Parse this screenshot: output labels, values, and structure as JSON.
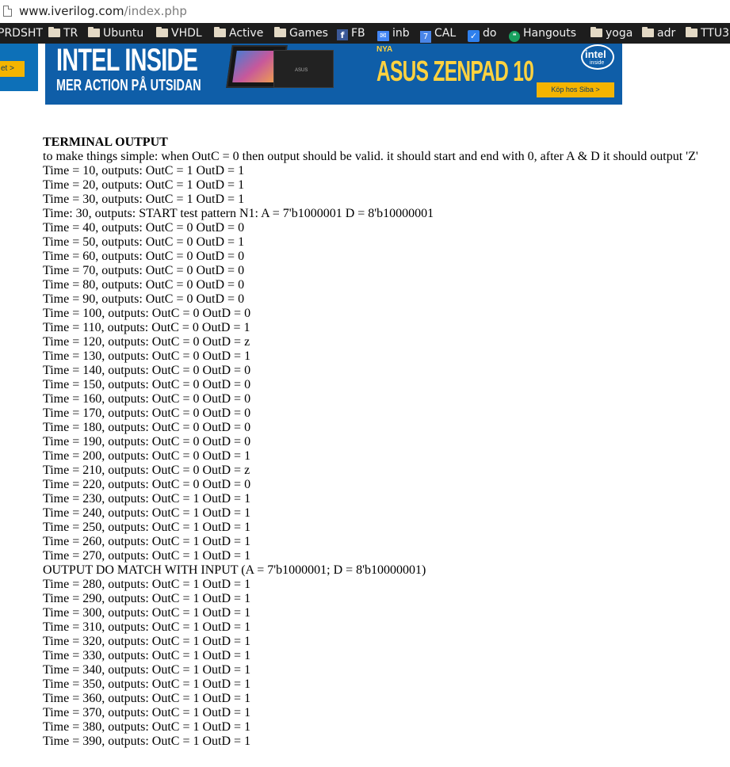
{
  "address_bar": {
    "domain": "www.iverilog.com",
    "path": "/index.php"
  },
  "bookmarks": [
    {
      "label": "PRDSHT",
      "icon": "none"
    },
    {
      "label": "TR",
      "icon": "folder-icon"
    },
    {
      "label": "Ubuntu",
      "icon": "folder-icon"
    },
    {
      "label": "VHDL",
      "icon": "folder-icon"
    },
    {
      "label": "Active",
      "icon": "folder-icon"
    },
    {
      "label": "Games",
      "icon": "folder-icon"
    },
    {
      "label": "FB",
      "icon": "facebook-icon"
    },
    {
      "label": "inb",
      "icon": "inbox-icon"
    },
    {
      "label": "CAL",
      "icon": "calendar-icon"
    },
    {
      "label": "do",
      "icon": "checkmark-icon"
    },
    {
      "label": "Hangouts",
      "icon": "hangouts-icon"
    },
    {
      "label": "yoga",
      "icon": "folder-icon"
    },
    {
      "label": "adr",
      "icon": "folder-icon"
    },
    {
      "label": "TTU3",
      "icon": "folder-icon"
    }
  ],
  "ads": {
    "side_button": "et >",
    "banner": {
      "headline": "INTEL INSIDE",
      "tagline": "MER ACTION PÅ UTSIDAN",
      "tablet_logo": "ASUS",
      "kicker": "NYA",
      "product": "ASUS ZENPAD 10",
      "intel_word": "intel",
      "intel_sub": "inside",
      "cta": "Köp hos Siba >"
    }
  },
  "terminal": {
    "heading": "TERMINAL OUTPUT",
    "lines": [
      "to make things simple: when OutC = 0 then output should be valid. it should start and end with 0, after A & D it should output 'Z'",
      "Time = 10, outputs: OutC = 1 OutD = 1",
      "Time = 20, outputs: OutC = 1 OutD = 1",
      "Time = 30, outputs: OutC = 1 OutD = 1",
      "Time: 30, outputs: START test pattern N1: A = 7'b1000001 D = 8'b10000001",
      "Time = 40, outputs: OutC = 0 OutD = 0",
      "Time = 50, outputs: OutC = 0 OutD = 1",
      "Time = 60, outputs: OutC = 0 OutD = 0",
      "Time = 70, outputs: OutC = 0 OutD = 0",
      "Time = 80, outputs: OutC = 0 OutD = 0",
      "Time = 90, outputs: OutC = 0 OutD = 0",
      "Time = 100, outputs: OutC = 0 OutD = 0",
      "Time = 110, outputs: OutC = 0 OutD = 1",
      "Time = 120, outputs: OutC = 0 OutD = z",
      "Time = 130, outputs: OutC = 0 OutD = 1",
      "Time = 140, outputs: OutC = 0 OutD = 0",
      "Time = 150, outputs: OutC = 0 OutD = 0",
      "Time = 160, outputs: OutC = 0 OutD = 0",
      "Time = 170, outputs: OutC = 0 OutD = 0",
      "Time = 180, outputs: OutC = 0 OutD = 0",
      "Time = 190, outputs: OutC = 0 OutD = 0",
      "Time = 200, outputs: OutC = 0 OutD = 1",
      "Time = 210, outputs: OutC = 0 OutD = z",
      "Time = 220, outputs: OutC = 0 OutD = 0",
      "Time = 230, outputs: OutC = 1 OutD = 1",
      "Time = 240, outputs: OutC = 1 OutD = 1",
      "Time = 250, outputs: OutC = 1 OutD = 1",
      "Time = 260, outputs: OutC = 1 OutD = 1",
      "Time = 270, outputs: OutC = 1 OutD = 1",
      "OUTPUT DO MATCH WITH INPUT (A = 7'b1000001; D = 8'b10000001)",
      "Time = 280, outputs: OutC = 1 OutD = 1",
      "Time = 290, outputs: OutC = 1 OutD = 1",
      "Time = 300, outputs: OutC = 1 OutD = 1",
      "Time = 310, outputs: OutC = 1 OutD = 1",
      "Time = 320, outputs: OutC = 1 OutD = 1",
      "Time = 330, outputs: OutC = 1 OutD = 1",
      "Time = 340, outputs: OutC = 1 OutD = 1",
      "Time = 350, outputs: OutC = 1 OutD = 1",
      "Time = 360, outputs: OutC = 1 OutD = 1",
      "Time = 370, outputs: OutC = 1 OutD = 1",
      "Time = 380, outputs: OutC = 1 OutD = 1",
      "Time = 390, outputs: OutC = 1 OutD = 1"
    ]
  }
}
